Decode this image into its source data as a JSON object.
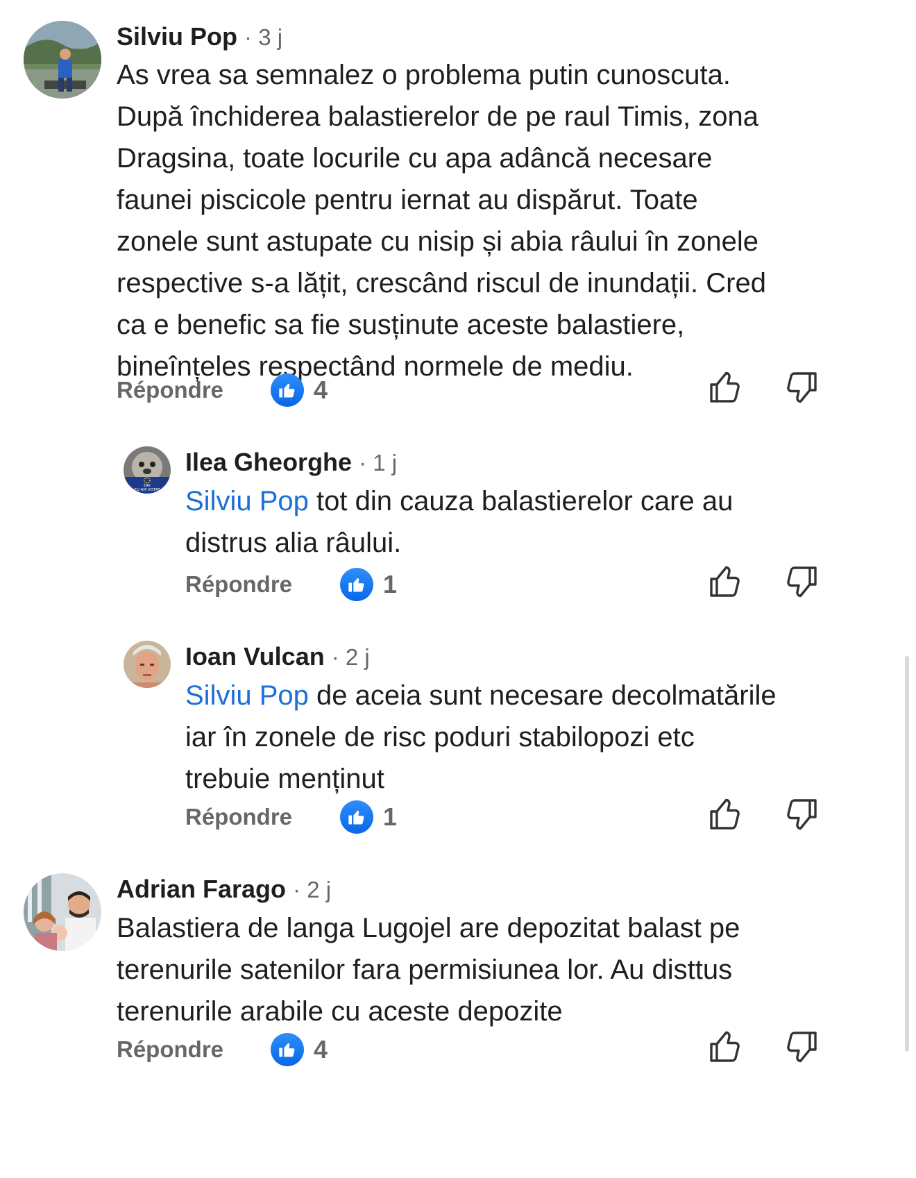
{
  "comments": [
    {
      "author": "Silviu Pop",
      "time": "· 3 j",
      "text": "As vrea sa semnalez o problema putin cunoscuta.\nDupă închiderea balastierelor de pe raul Timis, zona\nDragsina, toate locurile cu apa adâncă necesare\nfaunei piscicole pentru iernat au dispărut. Toate\nzonele sunt astupate cu nisip și abia râului în zonele\nrespective s-a lățit, crescând riscul de inundații. Cred\nca e benefic sa fie susținute aceste balastiere,\nbineînțeles respectând normele de mediu.",
      "reply_label": "Répondre",
      "like_count": "4"
    },
    {
      "author": "Ilea Gheorghe",
      "time": "· 1 j",
      "mention": "Silviu Pop",
      "text": " tot din cauza balastierelor  care au\ndistrus alia râului.",
      "reply_label": "Répondre",
      "like_count": "1",
      "avatar_badge": "DAI\nEU AM VOTAT"
    },
    {
      "author": "Ioan Vulcan",
      "time": "· 2 j",
      "mention": "Silviu Pop",
      "text": " de aceia sunt necesare decolmatările\niar în zonele de risc poduri stabilopozi etc\ntrebuie menținut",
      "reply_label": "Répondre",
      "like_count": "1"
    },
    {
      "author": "Adrian Farago",
      "time": "· 2 j",
      "text": "Balastiera de langa Lugojel are depozitat balast pe\nterenurile satenilor fara permisiunea lor. Au disttus\nterenurile arabile cu aceste depozite",
      "reply_label": "Répondre",
      "like_count": "4"
    }
  ],
  "icons": {
    "like_badge": "thumbs-up-icon",
    "upvote": "thumbs-up-outline-icon",
    "downvote": "thumbs-down-outline-icon"
  },
  "colors": {
    "mention": "#1b6fd8",
    "like_badge": "#1877f2",
    "muted": "#65676b"
  }
}
